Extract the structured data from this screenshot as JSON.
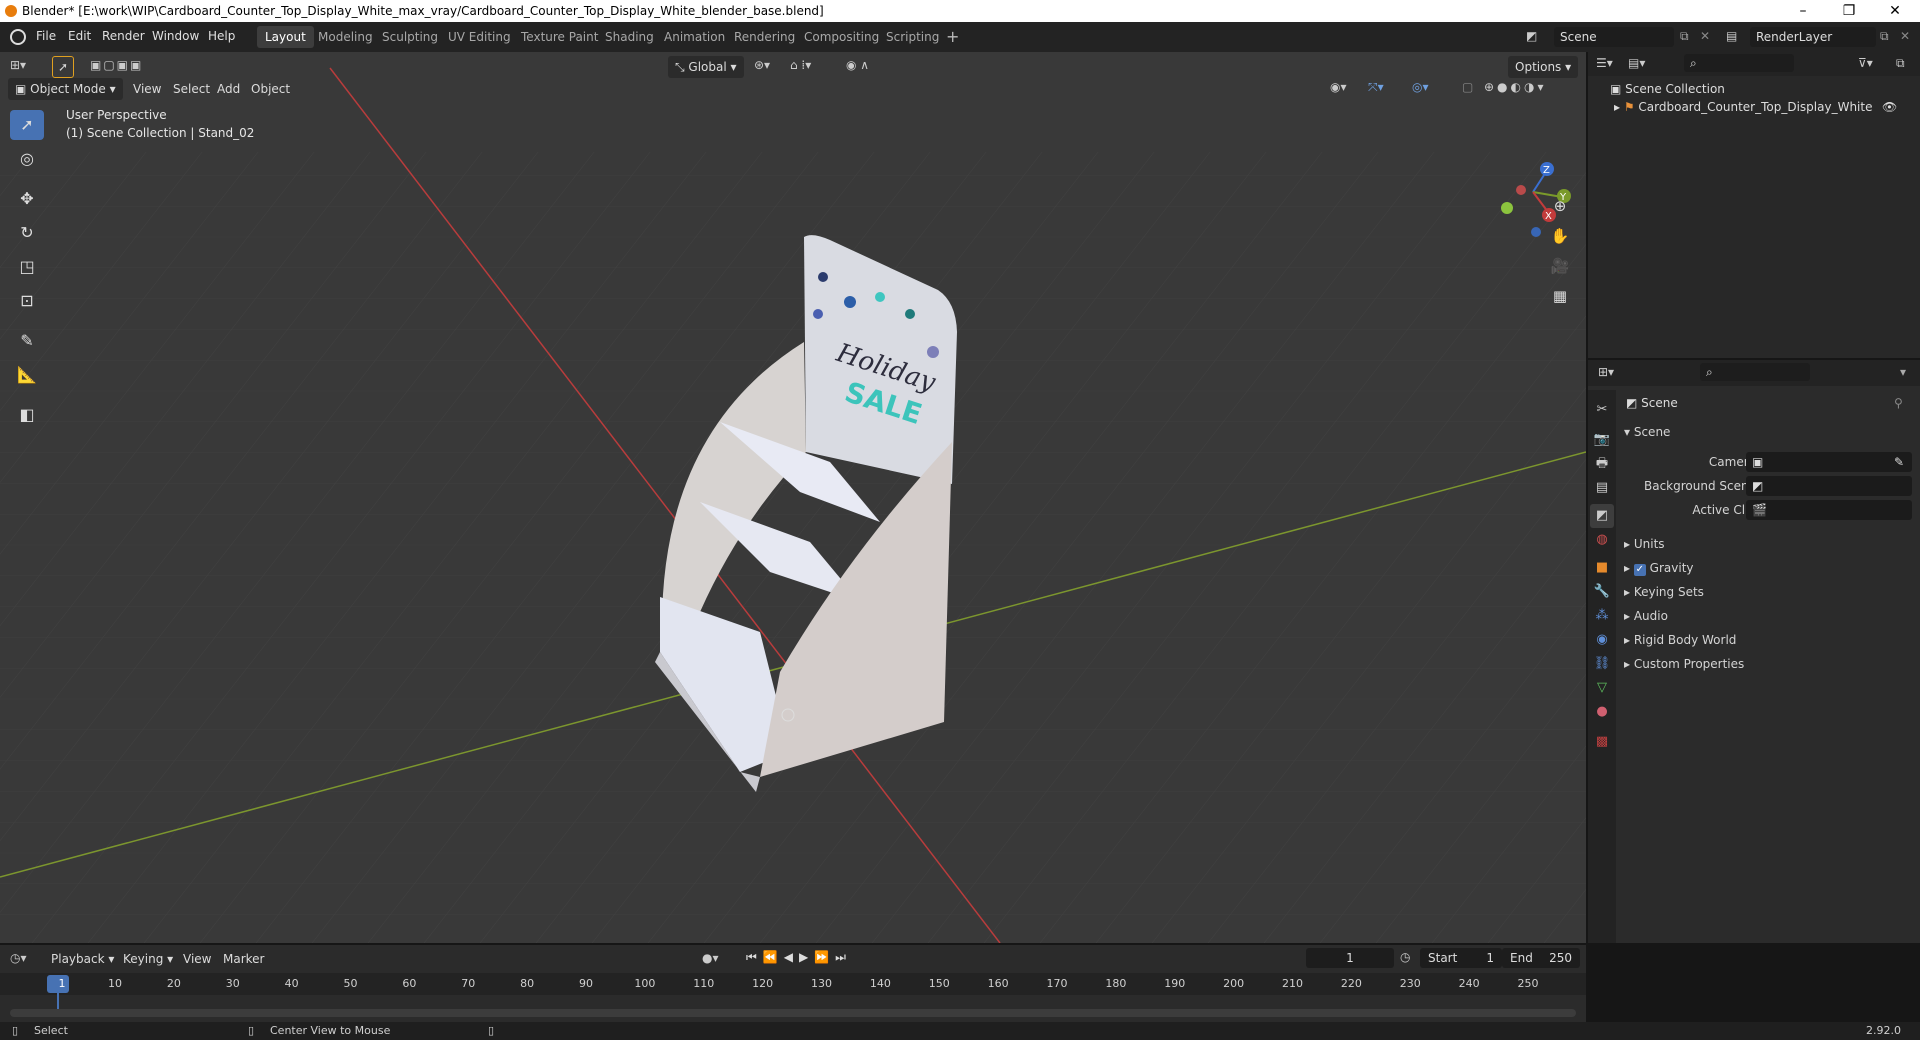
{
  "window": {
    "title": "Blender* [E:\\work\\WIP\\Cardboard_Counter_Top_Display_White_max_vray/Cardboard_Counter_Top_Display_White_blender_base.blend]",
    "minimize": "–",
    "maximize": "❐",
    "close": "✕"
  },
  "menus": [
    "File",
    "Edit",
    "Render",
    "Window",
    "Help"
  ],
  "workspaces": [
    "Layout",
    "Modeling",
    "Sculpting",
    "UV Editing",
    "Texture Paint",
    "Shading",
    "Animation",
    "Rendering",
    "Compositing",
    "Scripting"
  ],
  "active_workspace": "Layout",
  "scene_field": "Scene",
  "renderlayer_field": "RenderLayer",
  "viewport": {
    "mode": "Object Mode",
    "menus": [
      "View",
      "Select",
      "Add",
      "Object"
    ],
    "transform_orientation": "Global",
    "options_label": "Options",
    "overlay_title": "User Perspective",
    "overlay_sub": "(1) Scene Collection | Stand_02",
    "gizmo": {
      "x": "X",
      "y": "Y",
      "z": "Z"
    }
  },
  "outliner": {
    "root": "Scene Collection",
    "items": [
      {
        "label": "Cardboard_Counter_Top_Display_White"
      }
    ]
  },
  "properties": {
    "header": "Scene",
    "panel": "Scene",
    "fields": [
      {
        "label": "Camera",
        "value": ""
      },
      {
        "label": "Background Scene",
        "value": ""
      },
      {
        "label": "Active Clip",
        "value": ""
      }
    ],
    "sections": [
      "Units",
      "Gravity",
      "Keying Sets",
      "Audio",
      "Rigid Body World",
      "Custom Properties"
    ],
    "gravity_checked": true
  },
  "timeline": {
    "menus": [
      "Playback",
      "Keying",
      "View",
      "Marker"
    ],
    "current_frame": "1",
    "start_label": "Start",
    "start": "1",
    "end_label": "End",
    "end": "250",
    "ticks": [
      "1",
      "10",
      "20",
      "30",
      "40",
      "50",
      "60",
      "70",
      "80",
      "90",
      "100",
      "110",
      "120",
      "130",
      "140",
      "150",
      "160",
      "170",
      "180",
      "190",
      "200",
      "210",
      "220",
      "230",
      "240",
      "250"
    ]
  },
  "status": {
    "left": "Select",
    "middle": "Center View to Mouse",
    "version": "2.92.0"
  },
  "model_text": {
    "line1": "Holiday",
    "line2": "SALE"
  },
  "colors": {
    "accent": "#4772b3",
    "x_axis": "#c23b3b",
    "y_axis": "#7a9a2a",
    "z_axis": "#3a6fd1"
  }
}
